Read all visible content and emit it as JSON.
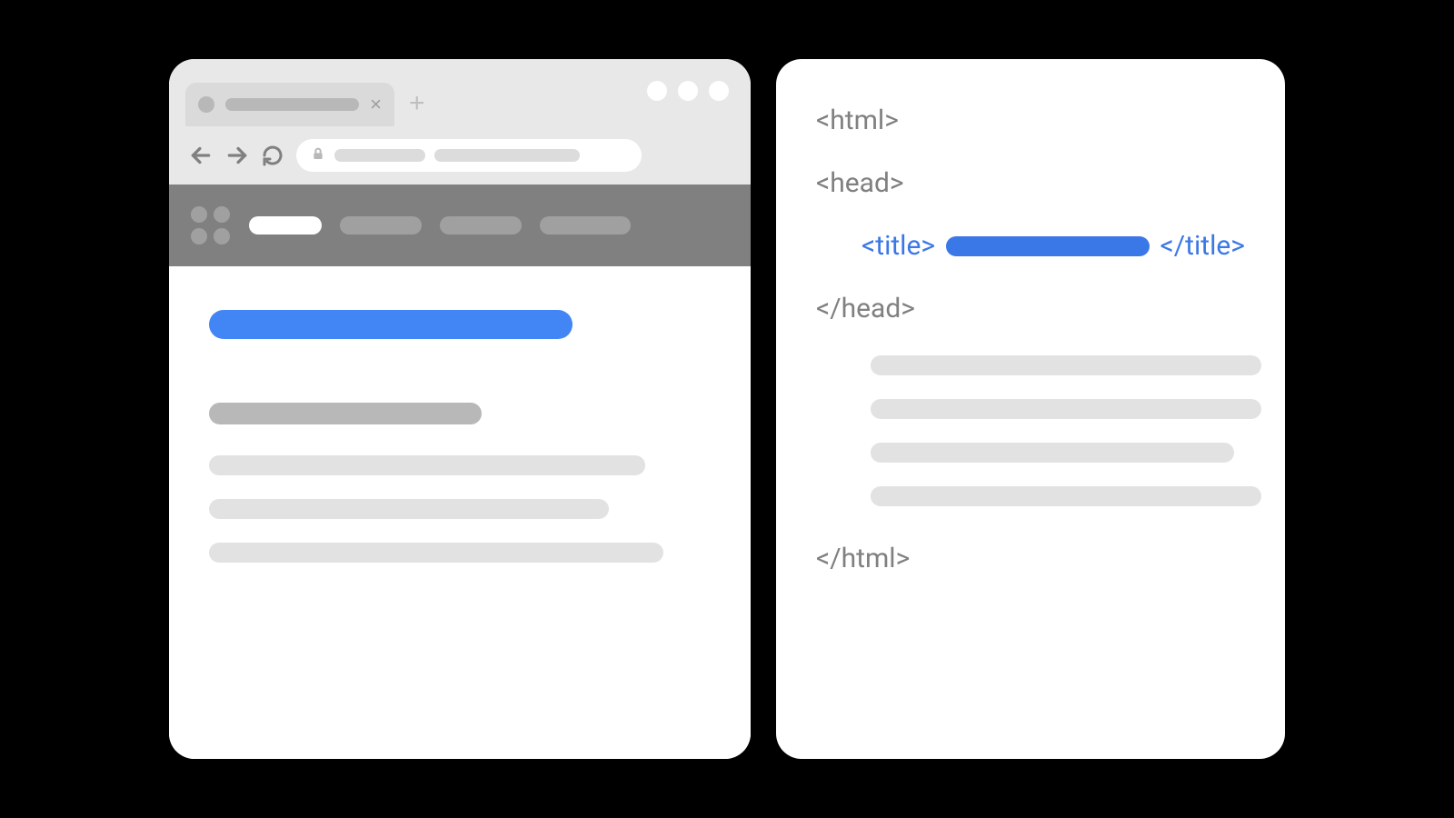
{
  "colors": {
    "accent_blue": "#4285f4",
    "code_blue": "#3b78e7",
    "placeholder_light": "#e2e2e2",
    "placeholder_mid": "#b8b8b8",
    "chrome_bg": "#e8e8e8",
    "sitebar_bg": "#808080"
  },
  "browser": {
    "tab_close_glyph": "×",
    "new_tab_glyph": "+",
    "window_control_count": 3,
    "nav_pill_widths": [
      80,
      90,
      90,
      100
    ]
  },
  "code": {
    "html_open": "<html>",
    "head_open": "<head>",
    "title_open": "<title>",
    "title_close": "</title>",
    "head_close": "</head>",
    "html_close": "</html>",
    "body_blob_widths": [
      430,
      430,
      400,
      430
    ]
  },
  "page": {
    "paragraph_widths": [
      480,
      440,
      500
    ]
  }
}
